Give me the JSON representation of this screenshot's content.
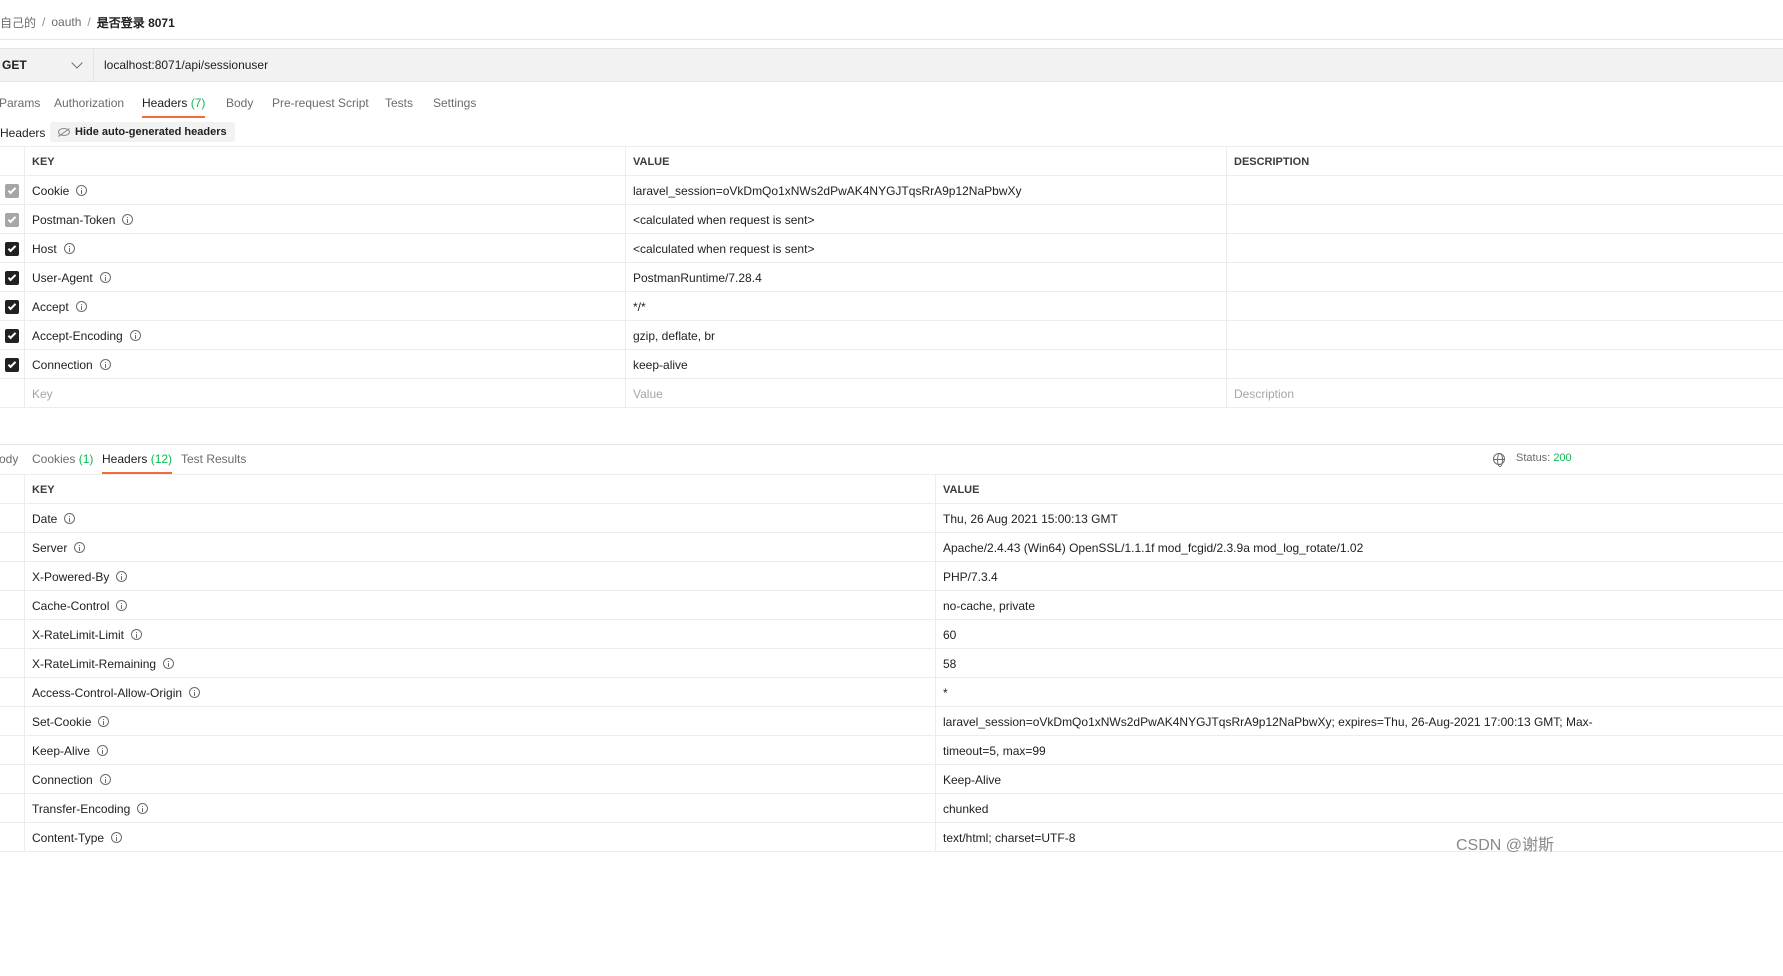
{
  "breadcrumb": {
    "item1": "自己的",
    "item2": "oauth",
    "current": "是否登录 8071",
    "separator": "/"
  },
  "request": {
    "method": "GET",
    "url": "localhost:8071/api/sessionuser"
  },
  "request_tabs": [
    {
      "label": "Params"
    },
    {
      "label": "Authorization"
    },
    {
      "label": "Headers",
      "count": "(7)"
    },
    {
      "label": "Body"
    },
    {
      "label": "Pre-request Script"
    },
    {
      "label": "Tests"
    },
    {
      "label": "Settings"
    }
  ],
  "headers_section": {
    "title": "Headers",
    "hide_button": "Hide auto-generated headers"
  },
  "request_headers": {
    "columns": {
      "key": "KEY",
      "value": "VALUE",
      "description": "DESCRIPTION"
    },
    "rows": [
      {
        "key": "Cookie",
        "value": "laravel_session=oVkDmQo1xNWs2dPwAK4NYGJTqsRrA9p12NaPbwXy",
        "checked": true,
        "disabled": true
      },
      {
        "key": "Postman-Token",
        "value": "<calculated when request is sent>",
        "checked": true,
        "disabled": true
      },
      {
        "key": "Host",
        "value": "<calculated when request is sent>",
        "checked": true,
        "disabled": false
      },
      {
        "key": "User-Agent",
        "value": "PostmanRuntime/7.28.4",
        "checked": true,
        "disabled": false
      },
      {
        "key": "Accept",
        "value": "*/*",
        "checked": true,
        "disabled": false
      },
      {
        "key": "Accept-Encoding",
        "value": "gzip, deflate, br",
        "checked": true,
        "disabled": false
      },
      {
        "key": "Connection",
        "value": "keep-alive",
        "checked": true,
        "disabled": false
      }
    ],
    "placeholders": {
      "key": "Key",
      "value": "Value",
      "description": "Description"
    }
  },
  "response_tabs": [
    {
      "label": "ody"
    },
    {
      "label": "Cookies",
      "count": "(1)"
    },
    {
      "label": "Headers",
      "count": "(12)"
    },
    {
      "label": "Test Results"
    }
  ],
  "response_status": {
    "label": "Status:",
    "value": "200"
  },
  "response_headers": {
    "columns": {
      "key": "KEY",
      "value": "VALUE"
    },
    "rows": [
      {
        "key": "Date",
        "value": "Thu, 26 Aug 2021 15:00:13 GMT"
      },
      {
        "key": "Server",
        "value": "Apache/2.4.43 (Win64) OpenSSL/1.1.1f mod_fcgid/2.3.9a mod_log_rotate/1.02"
      },
      {
        "key": "X-Powered-By",
        "value": "PHP/7.3.4"
      },
      {
        "key": "Cache-Control",
        "value": "no-cache, private"
      },
      {
        "key": "X-RateLimit-Limit",
        "value": "60"
      },
      {
        "key": "X-RateLimit-Remaining",
        "value": "58"
      },
      {
        "key": "Access-Control-Allow-Origin",
        "value": "*"
      },
      {
        "key": "Set-Cookie",
        "value": "laravel_session=oVkDmQo1xNWs2dPwAK4NYGJTqsRrA9p12NaPbwXy; expires=Thu, 26-Aug-2021 17:00:13 GMT; Max-"
      },
      {
        "key": "Keep-Alive",
        "value": "timeout=5, max=99"
      },
      {
        "key": "Connection",
        "value": "Keep-Alive"
      },
      {
        "key": "Transfer-Encoding",
        "value": "chunked"
      },
      {
        "key": "Content-Type",
        "value": "text/html; charset=UTF-8"
      }
    ]
  },
  "watermark": "CSDN @谢斯",
  "colors": {
    "accent": "#f26b3a",
    "count_green": "#0cbb52",
    "checkbox": "#212121",
    "checkbox_disabled": "#a6a6a6"
  },
  "icons": {
    "info": "info-icon",
    "globe": "globe-icon",
    "chevron": "chevron-down-icon",
    "eye_off": "eye-off-icon",
    "check": "check-icon"
  }
}
